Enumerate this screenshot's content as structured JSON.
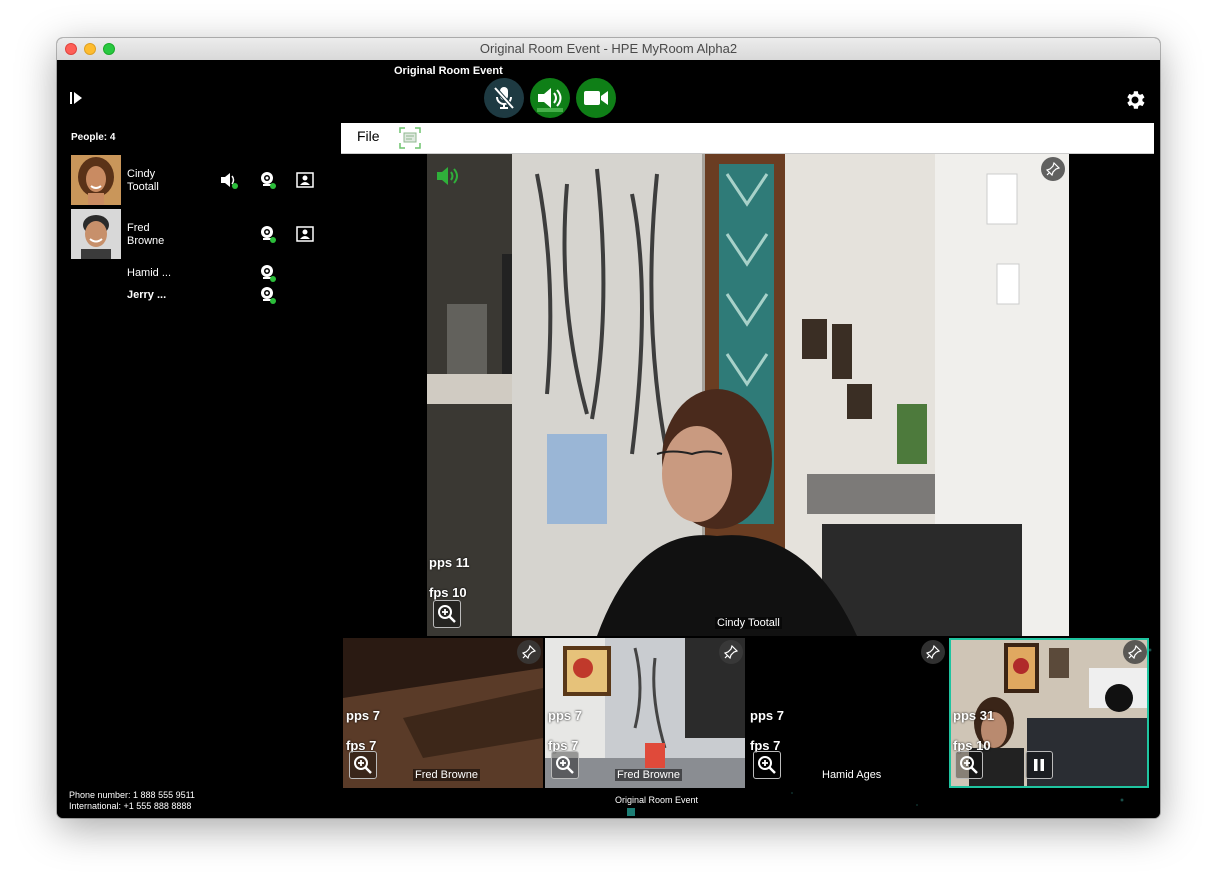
{
  "window": {
    "title": "Original Room Event - HPE MyRoom Alpha2"
  },
  "header": {
    "event_title": "Original Room Event"
  },
  "sidebar": {
    "people_count": "People: 4",
    "people": [
      {
        "first": "Cindy",
        "last": "Tootall",
        "bold": false
      },
      {
        "first": "Fred",
        "last": "Browne",
        "bold": false
      },
      {
        "name": "Hamid ...",
        "bold": false
      },
      {
        "name": "Jerry ...",
        "bold": true
      }
    ],
    "phone": "Phone number: 1 888 555 9511",
    "international": "International:  +1 555 888 8888"
  },
  "menu": {
    "file": "File"
  },
  "main_video": {
    "name": "Cindy Tootall",
    "pps": "pps 11",
    "fps": "fps 10"
  },
  "thumbnails": [
    {
      "name": "Fred Browne",
      "pps": "pps 7",
      "fps": "fps 7"
    },
    {
      "name": "Fred Browne",
      "pps": "pps 7",
      "fps": "fps 7"
    },
    {
      "name": "Hamid Ages",
      "pps": "pps 7",
      "fps": "fps 7"
    },
    {
      "name": "",
      "pps": "pps 31",
      "fps": "fps 10"
    }
  ],
  "footer": {
    "event_title": "Original Room Event"
  },
  "colors": {
    "accent_green": "#0f7f17",
    "active_border": "#1fc4a0",
    "mic_muted_bg": "#1e3a42"
  }
}
